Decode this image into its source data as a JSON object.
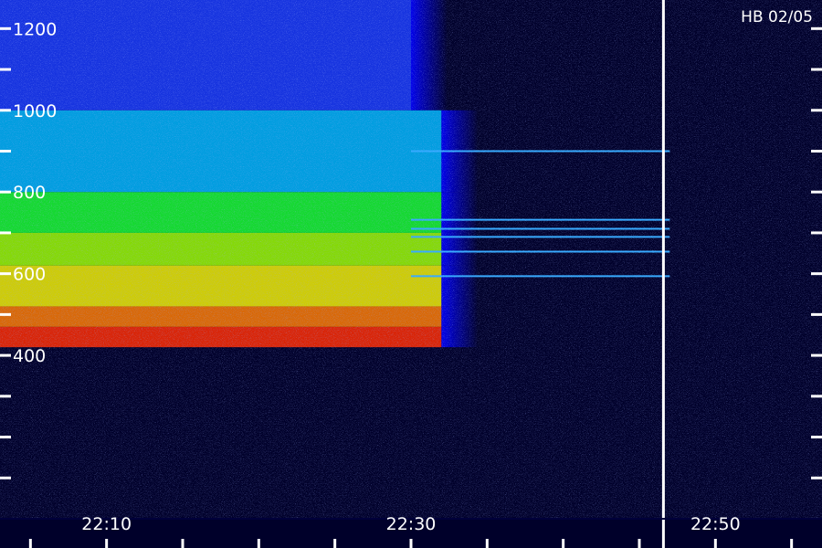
{
  "chart_data": {
    "type": "heatmap",
    "title": "",
    "annotation": "HB 02/05",
    "xlabel": "",
    "ylabel": "",
    "x_unit": "time (hh:mm)",
    "xlim": [
      "22:03:00",
      "22:57:00"
    ],
    "ylim": [
      0,
      1270
    ],
    "x_ticks": [
      "22:10",
      "22:30",
      "22:50"
    ],
    "y_ticks": [
      400,
      600,
      800,
      1000,
      1200
    ],
    "y_tick_labels": [
      "400",
      "600",
      "800",
      "1000",
      "1200"
    ],
    "y_tick_label_sides": [
      "left"
    ],
    "vertical_marker_time": "22:46:35",
    "colormap": [
      "#000033",
      "#0000ff",
      "#00aaff",
      "#00ff66",
      "#ffff00",
      "#ff0000"
    ],
    "bands": [
      {
        "y_range": [
          420,
          470
        ],
        "time_range": [
          "22:03",
          "22:32"
        ],
        "level": "red"
      },
      {
        "y_range": [
          470,
          520
        ],
        "time_range": [
          "22:03",
          "22:32"
        ],
        "level": "orange"
      },
      {
        "y_range": [
          520,
          620
        ],
        "time_range": [
          "22:03",
          "22:32"
        ],
        "level": "yellow"
      },
      {
        "y_range": [
          620,
          700
        ],
        "time_range": [
          "22:03",
          "22:32"
        ],
        "level": "yellow-green"
      },
      {
        "y_range": [
          700,
          800
        ],
        "time_range": [
          "22:03",
          "22:32"
        ],
        "level": "green"
      },
      {
        "y_range": [
          800,
          1000
        ],
        "time_range": [
          "22:03",
          "22:32"
        ],
        "level": "cyan"
      },
      {
        "y_range": [
          1000,
          1270
        ],
        "time_range": [
          "22:03",
          "22:30"
        ],
        "level": "blue"
      }
    ],
    "narrowband_lines": [
      {
        "y": 594,
        "time_range": [
          "22:30",
          "22:47"
        ]
      },
      {
        "y": 654,
        "time_range": [
          "22:30",
          "22:47"
        ]
      },
      {
        "y": 690,
        "time_range": [
          "22:30",
          "22:47"
        ]
      },
      {
        "y": 710,
        "time_range": [
          "22:30",
          "22:47"
        ]
      },
      {
        "y": 732,
        "time_range": [
          "22:30",
          "22:47"
        ]
      },
      {
        "y": 900,
        "time_range": [
          "22:30",
          "22:47"
        ]
      }
    ]
  }
}
